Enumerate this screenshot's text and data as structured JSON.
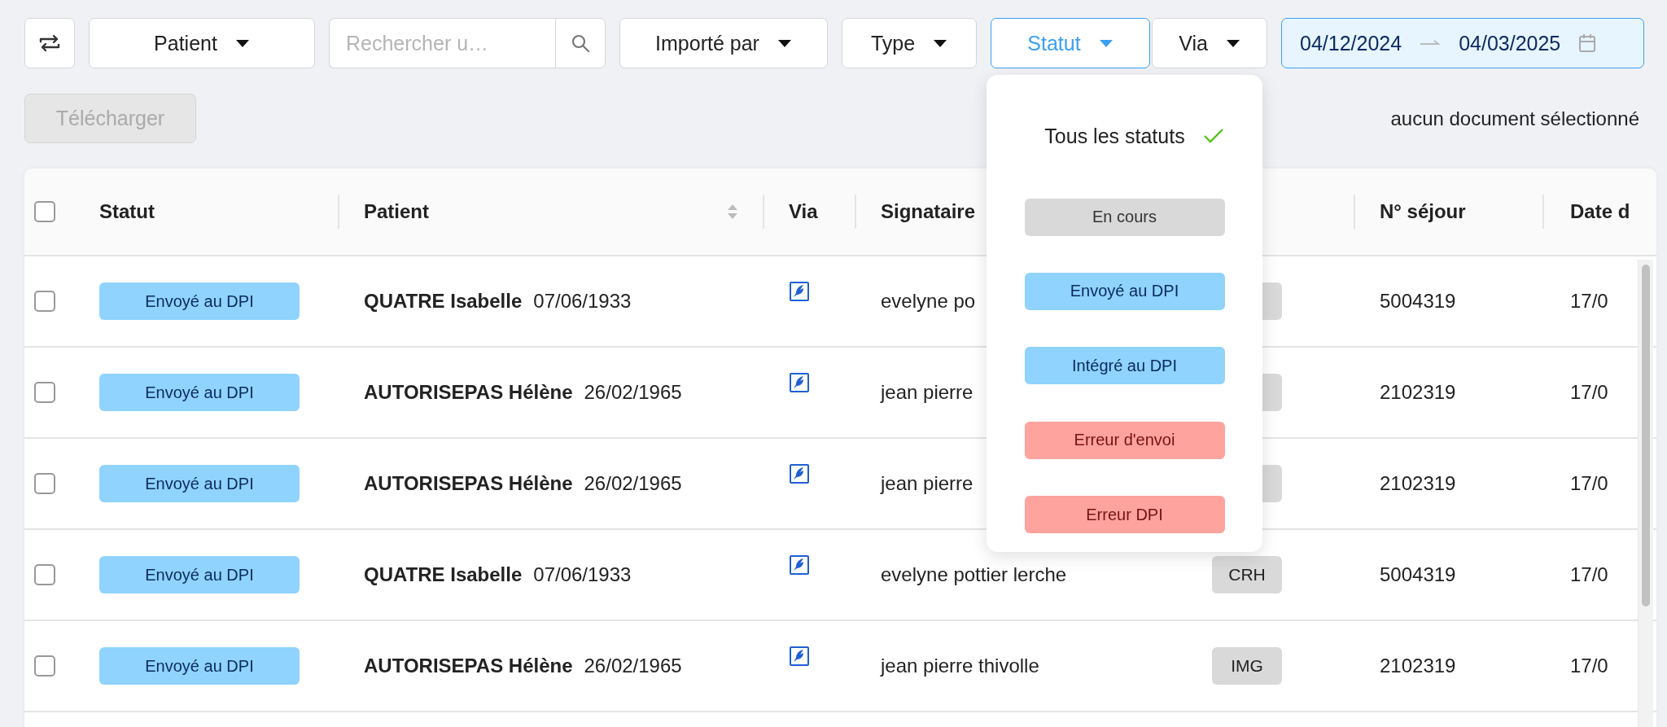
{
  "toolbar": {
    "filters": [
      {
        "kind": "swap"
      },
      {
        "kind": "dropdown",
        "label": "Patient",
        "active": false
      },
      {
        "kind": "search",
        "placeholder": "Rechercher u…"
      },
      {
        "kind": "dropdown",
        "label": "Importé par",
        "active": false
      },
      {
        "kind": "dropdown",
        "label": "Type",
        "active": false
      },
      {
        "kind": "dropdown",
        "label": "Statut",
        "active": true
      },
      {
        "kind": "dropdown",
        "label": "Via",
        "active": false
      },
      {
        "kind": "daterange",
        "start": "04/12/2024",
        "end": "04/03/2025",
        "active": true
      }
    ]
  },
  "download_button": {
    "label": "Télécharger",
    "disabled": true
  },
  "selection_info": "aucun document sélectionné",
  "status_menu": {
    "options": [
      {
        "kind": "all",
        "label": "Tous les statuts",
        "selected": true
      },
      {
        "kind": "neutral",
        "label": "En cours",
        "selected": false
      },
      {
        "kind": "info",
        "label": "Envoyé au DPI",
        "selected": false
      },
      {
        "kind": "info",
        "label": "Intégré au DPI",
        "selected": false
      },
      {
        "kind": "error",
        "label": "Erreur d'envoi",
        "selected": false
      },
      {
        "kind": "error",
        "label": "Erreur DPI",
        "selected": false
      }
    ]
  },
  "table": {
    "select_all_checked": false,
    "columns": [
      {
        "label": "Statut",
        "sortable": false
      },
      {
        "label": "Patient",
        "sortable": true
      },
      {
        "label": "Via",
        "sortable": false
      },
      {
        "label": "Signataire",
        "sortable": false
      },
      {
        "label": "N° séjour",
        "sortable": false
      },
      {
        "label": "Date d",
        "sortable": false
      }
    ],
    "rows": [
      {
        "checked": false,
        "status": {
          "kind": "info",
          "label": "Envoyé au DPI"
        },
        "patient": "QUATRE Isabelle",
        "birth_date": "07/06/1933",
        "signatory": "evelyne po",
        "stay": "5004319",
        "date": "17/0"
      },
      {
        "checked": false,
        "status": {
          "kind": "info",
          "label": "Envoyé au DPI"
        },
        "patient": "AUTORISEPAS Hélène",
        "birth_date": "26/02/1965",
        "signatory": "jean pierre",
        "stay": "2102319",
        "date": "17/0"
      },
      {
        "checked": false,
        "status": {
          "kind": "info",
          "label": "Envoyé au DPI"
        },
        "patient": "AUTORISEPAS Hélène",
        "birth_date": "26/02/1965",
        "signatory": "jean pierre",
        "stay": "2102319",
        "date": "17/0"
      },
      {
        "checked": false,
        "status": {
          "kind": "info",
          "label": "Envoyé au DPI"
        },
        "patient": "QUATRE Isabelle",
        "birth_date": "07/06/1933",
        "signatory": "evelyne pottier lerche",
        "type": "CRH",
        "stay": "5004319",
        "date": "17/0"
      },
      {
        "checked": false,
        "status": {
          "kind": "info",
          "label": "Envoyé au DPI"
        },
        "patient": "AUTORISEPAS Hélène",
        "birth_date": "26/02/1965",
        "signatory": "jean pierre thivolle",
        "type": "IMG",
        "stay": "2102319",
        "date": "17/0"
      }
    ]
  }
}
